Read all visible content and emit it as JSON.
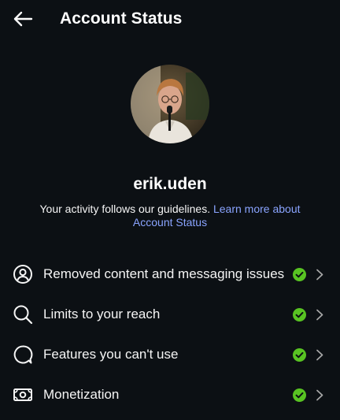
{
  "header": {
    "title": "Account Status",
    "back_icon": "arrow-left-icon"
  },
  "profile": {
    "username": "erik.uden",
    "avatar_icon": "profile-photo"
  },
  "status": {
    "message": "Your activity follows our guidelines.",
    "link_text": "Learn more about Account Status"
  },
  "items": [
    {
      "label": "Removed content and messaging issues",
      "icon": "user-circle-icon",
      "status": "ok"
    },
    {
      "label": "Limits to your reach",
      "icon": "search-icon",
      "status": "ok"
    },
    {
      "label": "Features you can't use",
      "icon": "speech-bubble-icon",
      "status": "ok"
    },
    {
      "label": "Monetization",
      "icon": "money-icon",
      "status": "ok"
    }
  ],
  "colors": {
    "background": "#0c1014",
    "text": "#f5f5f5",
    "link": "#8aa4ff",
    "ok_green": "#58c322"
  }
}
